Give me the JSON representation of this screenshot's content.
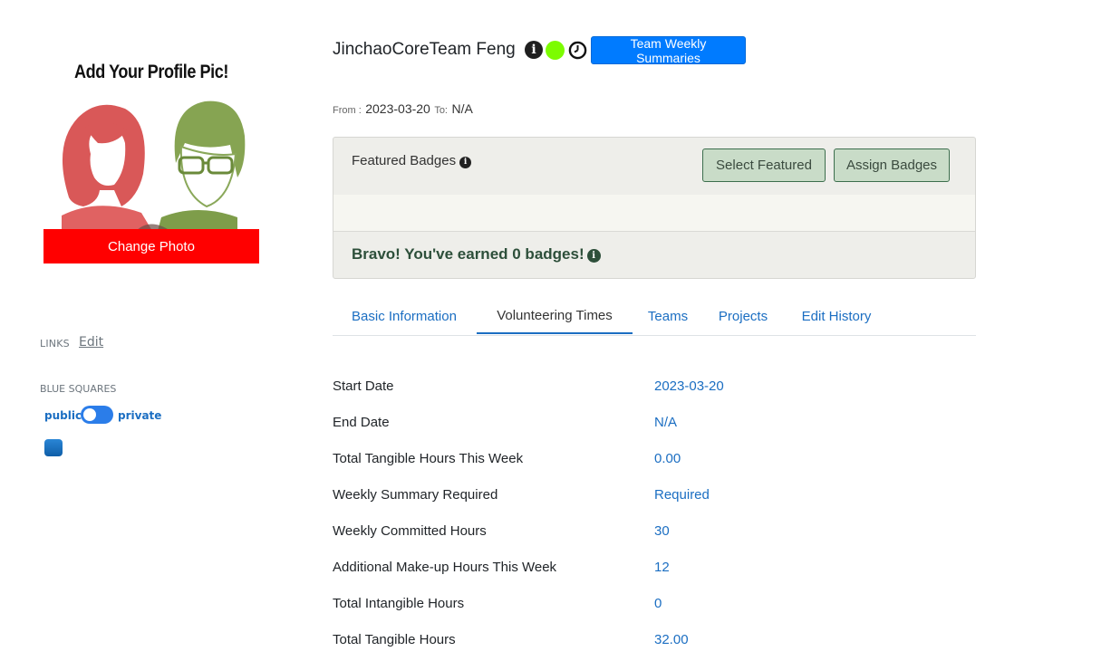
{
  "profile": {
    "pic_title": "Add Your Profile Pic!",
    "change_photo_label": "Change Photo",
    "links_label": "LINKS",
    "links_edit_label": "Edit",
    "blue_squares_label": "BLUE SQUARES",
    "visibility_public": "public",
    "visibility_private": "private",
    "visibility_state": "public"
  },
  "header": {
    "user_name": "JinchaoCoreTeam Feng",
    "status_color": "#7cfc00",
    "weekly_summaries_button": "Team Weekly Summaries",
    "from_label": "From :",
    "from_value": "2023-03-20",
    "to_label": "To:",
    "to_value": "N/A"
  },
  "badges": {
    "title": "Featured Badges",
    "select_featured_label": "Select Featured",
    "assign_badges_label": "Assign Badges",
    "earned_message": "Bravo! You've earned 0 badges!"
  },
  "tabs": [
    {
      "label": "Basic Information",
      "active": false
    },
    {
      "label": "Volunteering Times",
      "active": true
    },
    {
      "label": "Teams",
      "active": false
    },
    {
      "label": "Projects",
      "active": false
    },
    {
      "label": "Edit History",
      "active": false
    }
  ],
  "volunteering": [
    {
      "label": "Start Date",
      "value": "2023-03-20"
    },
    {
      "label": "End Date",
      "value": "N/A"
    },
    {
      "label": "Total Tangible Hours This Week",
      "value": "0.00"
    },
    {
      "label": "Weekly Summary Required",
      "value": "Required"
    },
    {
      "label": "Weekly Committed Hours",
      "value": "30"
    },
    {
      "label": "Additional Make-up Hours This Week",
      "value": "12"
    },
    {
      "label": "Total Intangible Hours",
      "value": "0"
    },
    {
      "label": "Total Tangible Hours",
      "value": "32.00"
    }
  ],
  "colors": {
    "accent": "#1b6ec2",
    "primary_button": "#007bff",
    "change_photo": "#ff0000",
    "badge_button": "#c9dcc8"
  }
}
